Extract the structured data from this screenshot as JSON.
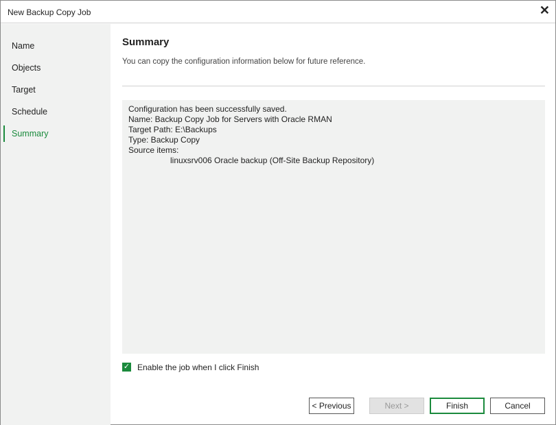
{
  "window": {
    "title": "New Backup Copy Job",
    "close": "✕"
  },
  "sidebar": {
    "items": [
      {
        "label": "Name"
      },
      {
        "label": "Objects"
      },
      {
        "label": "Target"
      },
      {
        "label": "Schedule"
      },
      {
        "label": "Summary"
      }
    ]
  },
  "main": {
    "heading": "Summary",
    "description": "You can copy the configuration information below for future reference.",
    "summary_lines": [
      "Configuration has been successfully saved.",
      "Name: Backup Copy Job for Servers with Oracle RMAN",
      "Target Path: E:\\Backups",
      "Type: Backup Copy",
      "Source items:"
    ],
    "source_item": "linuxsrv006 Oracle backup (Off-Site Backup Repository)",
    "enable_checkbox": {
      "label": "Enable the job when I click Finish",
      "checked": true
    }
  },
  "buttons": {
    "previous": "< Previous",
    "next": "Next >",
    "finish": "Finish",
    "cancel": "Cancel"
  },
  "colors": {
    "accent": "#1a8a3c"
  }
}
